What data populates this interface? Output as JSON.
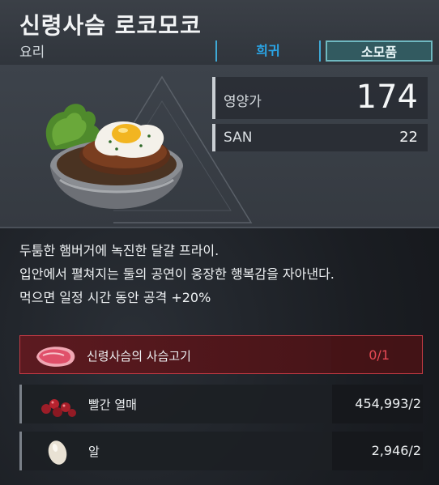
{
  "item": {
    "title": "신령사슴 로코모코",
    "category": "요리",
    "rarity_tag": "희귀",
    "type_tag": "소모품"
  },
  "stats": {
    "nutrition_label": "영양가",
    "nutrition_value": "174",
    "san_label": "SAN",
    "san_value": "22"
  },
  "description": [
    "두툼한 햄버거에 녹진한 달걀 프라이.",
    "입안에서 펼쳐지는 둘의 공연이 웅장한 행복감을 자아낸다.",
    "먹으면 일정 시간 동안 공격 +20%"
  ],
  "ingredients": [
    {
      "name": "신령사슴의 사슴고기",
      "count": "0/1",
      "icon": "meat-icon",
      "status": "missing"
    },
    {
      "name": "빨간 열매",
      "count": "454,993/2",
      "icon": "red-berries-icon",
      "status": "ok"
    },
    {
      "name": "알",
      "count": "2,946/2",
      "icon": "egg-icon",
      "status": "ok"
    }
  ],
  "colors": {
    "rarity": "#2aa6e8",
    "missing": "#e84a55",
    "consumable_bg": "#325a60"
  }
}
